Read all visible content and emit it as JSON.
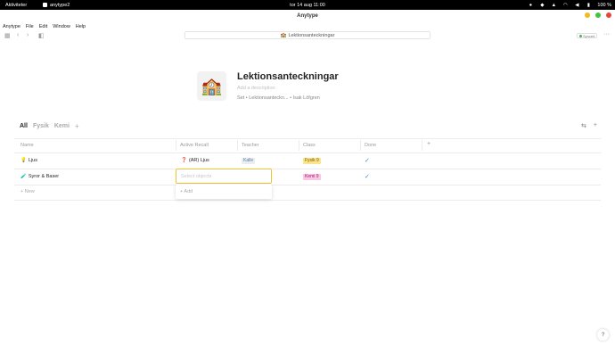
{
  "system": {
    "activities": "Aktiviteter",
    "app_name": "anytype2",
    "clock": "tor 14 aug  11:00",
    "battery": "100 %"
  },
  "window": {
    "title": "Anytype",
    "buttons": {
      "minimize": "#f5b920",
      "maximize": "#3ec43e",
      "close": "#e5473a"
    }
  },
  "menu": [
    "Anytype",
    "File",
    "Edit",
    "Window",
    "Help"
  ],
  "navbar": {
    "url_icon": "🏫",
    "url": "Lektionsanteckningar",
    "sync_status": "Synced"
  },
  "object": {
    "icon": "🏫",
    "title": "Lektionsanteckningar",
    "description_placeholder": "Add a description",
    "meta": "Set • Lektionsanteckn... • Isak Löfgren"
  },
  "views": {
    "tabs": [
      "All",
      "Fysik",
      "Kemi"
    ],
    "add": "+"
  },
  "table": {
    "columns": [
      "Name",
      "Active Recall",
      "Teacher",
      "Class",
      "Done"
    ],
    "add_column": "+",
    "rows": [
      {
        "name_icon": "💡",
        "name": "Ljus",
        "recall_icon": "❓",
        "recall": "(AR) Ljus",
        "teacher": "Kalle",
        "class": "Fysik 9",
        "class_color": "#fbe48a",
        "done": "✓"
      },
      {
        "name_icon": "🧪",
        "name": "Syror & Baser",
        "recall_icon": "",
        "recall": "",
        "teacher": "",
        "class": "Kemi 9",
        "class_color": "#f9c6e6",
        "done": "✓"
      }
    ],
    "new_row": "+ New"
  },
  "editor": {
    "placeholder": "Select objects",
    "add": "+ Add"
  },
  "help": "?"
}
